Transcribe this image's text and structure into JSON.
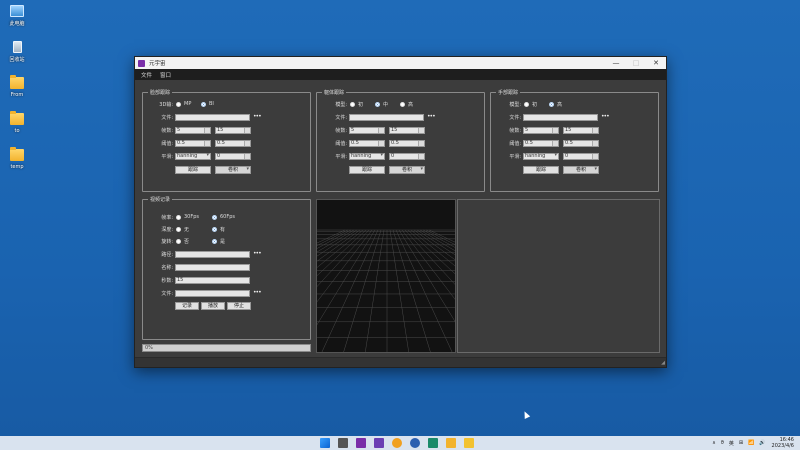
{
  "desktop": {
    "icons": [
      {
        "label": "此电脑",
        "icon": "computer-icon"
      },
      {
        "label": "回收站",
        "icon": "recycle-bin-icon"
      },
      {
        "label": "From",
        "icon": "folder-icon"
      },
      {
        "label": "to",
        "icon": "folder-icon"
      },
      {
        "label": "temp",
        "icon": "folder-icon"
      }
    ]
  },
  "window": {
    "title": "元宇宙",
    "controls": {
      "minimize": "—",
      "maximize": "□",
      "close": "✕"
    },
    "menu": [
      "文件",
      "窗口"
    ]
  },
  "face_panel": {
    "title": "脸部跟踪",
    "mode_label": "3D输:",
    "mode_options": [
      "MP",
      "BI"
    ],
    "mode_selected": "BI",
    "file_label": "文件:",
    "file_value": "",
    "fps_label": "帧数:",
    "fps_values": [
      "5",
      "15"
    ],
    "thresh_label": "阈值:",
    "thresh_values": [
      "0.5",
      "0.5"
    ],
    "smooth_label": "平滑:",
    "smooth_value": "hanning",
    "smooth_num": "0",
    "track_button": "跟踪",
    "select_value": "卷积"
  },
  "body_panel": {
    "title": "躯体跟踪",
    "model_label": "模型:",
    "model_options": [
      "初",
      "中",
      "高"
    ],
    "model_selected": "中",
    "file_label": "文件:",
    "file_value": "",
    "fps_label": "帧数:",
    "fps_values": [
      "5",
      "15"
    ],
    "thresh_label": "阈值:",
    "thresh_values": [
      "0.5",
      "0.5"
    ],
    "smooth_label": "平滑:",
    "smooth_value": "hanning",
    "smooth_num": "0",
    "track_button": "跟踪",
    "select_value": "卷积"
  },
  "hand_panel": {
    "title": "手部跟踪",
    "model_label": "模型:",
    "model_options": [
      "初",
      "高"
    ],
    "model_selected": "高",
    "file_label": "文件:",
    "file_value": "",
    "fps_label": "帧数:",
    "fps_values": [
      "5",
      "15"
    ],
    "thresh_label": "阈值:",
    "thresh_values": [
      "0.5",
      "0.5"
    ],
    "smooth_label": "平滑:",
    "smooth_value": "hanning",
    "smooth_num": "0",
    "track_button": "跟踪",
    "select_value": "卷积"
  },
  "video_panel": {
    "title": "视频记录",
    "fps_label": "帧率:",
    "fps_options": [
      "30Fps",
      "60Fps"
    ],
    "fps_selected": "60Fps",
    "depth_label": "深度:",
    "depth_options": [
      "无",
      "有"
    ],
    "depth_selected": "有",
    "rotate_label": "旋转:",
    "rotate_options": [
      "否",
      "是"
    ],
    "rotate_selected": "是",
    "path_label": "路径:",
    "path_value": "",
    "name_label": "名称:",
    "name_value": "",
    "seconds_label": "秒数:",
    "seconds_value": "15",
    "file_label": "文件:",
    "file_value": "",
    "buttons": [
      "记录",
      "播放",
      "停止"
    ],
    "progress_text": "0%"
  },
  "taskbar": {
    "tray_items": [
      "∧",
      "ϑ",
      "英",
      "⊞",
      "📶",
      "🔊"
    ],
    "time": "16:46",
    "date": "2023/4/6"
  }
}
